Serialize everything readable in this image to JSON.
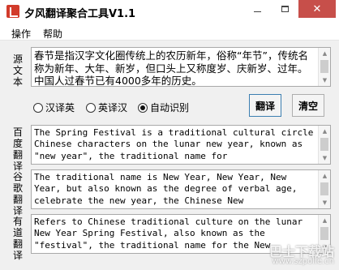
{
  "window": {
    "title": "夕风翻译聚合工具V1.1",
    "close_glyph": "✕"
  },
  "menu": {
    "items": [
      "操作",
      "帮助"
    ]
  },
  "source": {
    "label": "源文本",
    "text": "春节是指汉字文化圈传统上的农历新年，俗称“年节”，传统名称为新年、大年、新岁，但口头上又称度岁、庆新岁、过年。中国人过春节已有4000多年的历史。"
  },
  "options": {
    "radios": [
      {
        "label": "汉译英",
        "selected": false
      },
      {
        "label": "英译汉",
        "selected": false
      },
      {
        "label": "自动识别",
        "selected": true
      }
    ]
  },
  "buttons": {
    "translate": "翻译",
    "clear": "清空"
  },
  "results": [
    {
      "label": "百度翻译",
      "text": "The Spring Festival is a traditional cultural circle Chinese characters on the lunar new year, known as \"new year\", the traditional name for"
    },
    {
      "label": "谷歌翻译",
      "text": "The traditional name is New Year, New Year, New Year, but also known as the degree of verbal age, celebrate the new year, the Chinese New"
    },
    {
      "label": "有道翻译",
      "text": "Refers to Chinese traditional culture on the lunar New Year Spring Festival, also known as the \"festival\", the traditional name for the New"
    }
  ],
  "watermark": {
    "line1": "巴士下载站",
    "line2": "www.szpolle.cn"
  }
}
